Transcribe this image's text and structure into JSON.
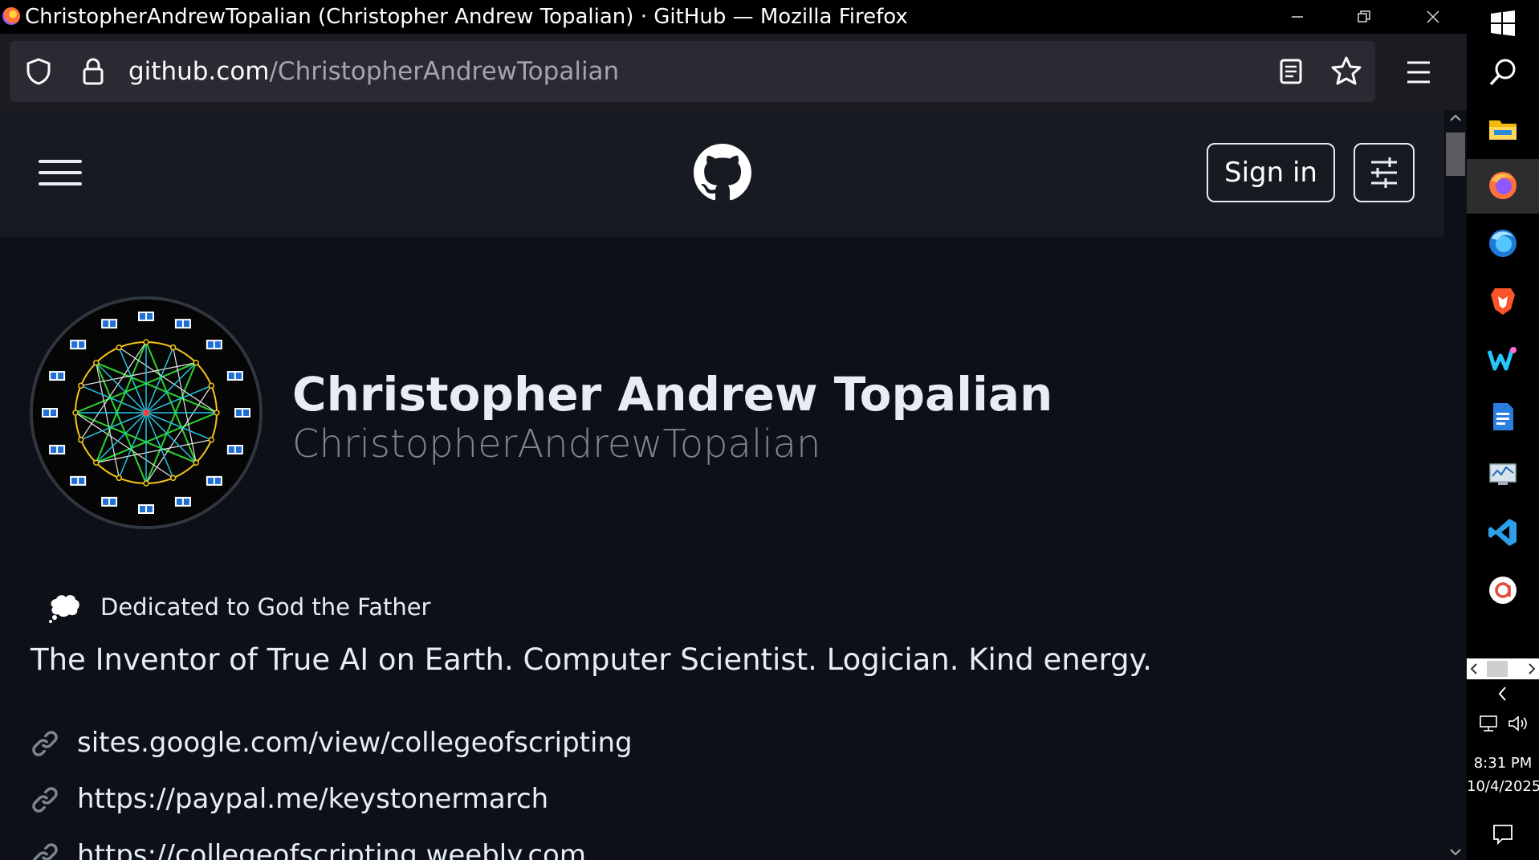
{
  "window": {
    "title": "ChristopherAndrewTopalian (Christopher Andrew Topalian) · GitHub — Mozilla Firefox"
  },
  "urlbar": {
    "host": "github.com",
    "path": "/ChristopherAndrewTopalian"
  },
  "header": {
    "sign_in_label": "Sign in"
  },
  "profile": {
    "full_name": "Christopher Andrew Topalian",
    "username": "ChristopherAndrewTopalian",
    "status": "Dedicated to God the Father",
    "bio": "The Inventor of True AI on Earth. Computer Scientist. Logician. Kind energy.",
    "links": [
      "sites.google.com/view/collegeofscripting",
      "https://paypal.me/keystonermarch",
      "https://collegeofscripting.weebly.com"
    ]
  },
  "taskbar": {
    "time": "8:31 PM",
    "date": "10/4/2025"
  }
}
